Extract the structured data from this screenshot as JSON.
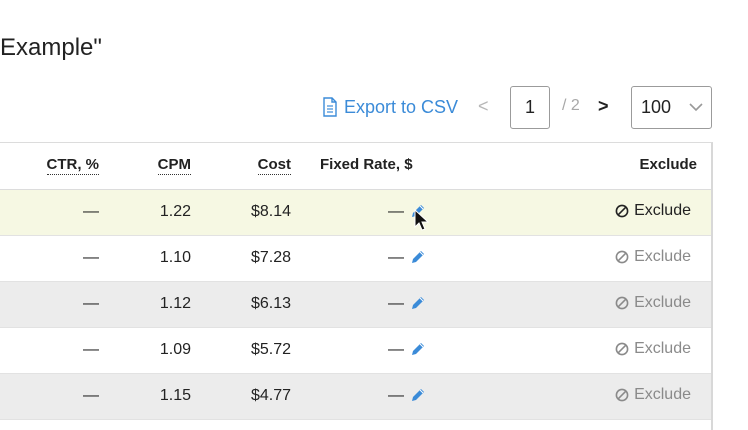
{
  "page": {
    "title": "Example\""
  },
  "toolbar": {
    "export_label": "Export to CSV",
    "prev": "<",
    "current_page": "1",
    "total_pages": "/ 2",
    "next": ">",
    "per_page": "100"
  },
  "table": {
    "headers": {
      "ctr": "CTR, %",
      "cpm": "CPM",
      "cost": "Cost",
      "fixed_rate": "Fixed Rate, $",
      "exclude": "Exclude"
    },
    "rows": [
      {
        "ctr": "—",
        "cpm": "1.22",
        "cost": "$8.14",
        "fixed_rate": "—",
        "exclude": "Exclude",
        "exclude_state": "active",
        "highlight": true
      },
      {
        "ctr": "—",
        "cpm": "1.10",
        "cost": "$7.28",
        "fixed_rate": "—",
        "exclude": "Exclude",
        "exclude_state": "muted"
      },
      {
        "ctr": "—",
        "cpm": "1.12",
        "cost": "$6.13",
        "fixed_rate": "—",
        "exclude": "Exclude",
        "exclude_state": "muted"
      },
      {
        "ctr": "—",
        "cpm": "1.09",
        "cost": "$5.72",
        "fixed_rate": "—",
        "exclude": "Exclude",
        "exclude_state": "muted"
      },
      {
        "ctr": "—",
        "cpm": "1.15",
        "cost": "$4.77",
        "fixed_rate": "—",
        "exclude": "Exclude",
        "exclude_state": "muted"
      }
    ]
  },
  "colors": {
    "link": "#3b8bd8",
    "highlight_row": "#f6f8e3",
    "alt_row": "#ececec"
  },
  "icons": {
    "export": "document-icon",
    "edit": "pencil-icon",
    "exclude": "ban-icon",
    "dropdown": "chevron-down-icon"
  }
}
